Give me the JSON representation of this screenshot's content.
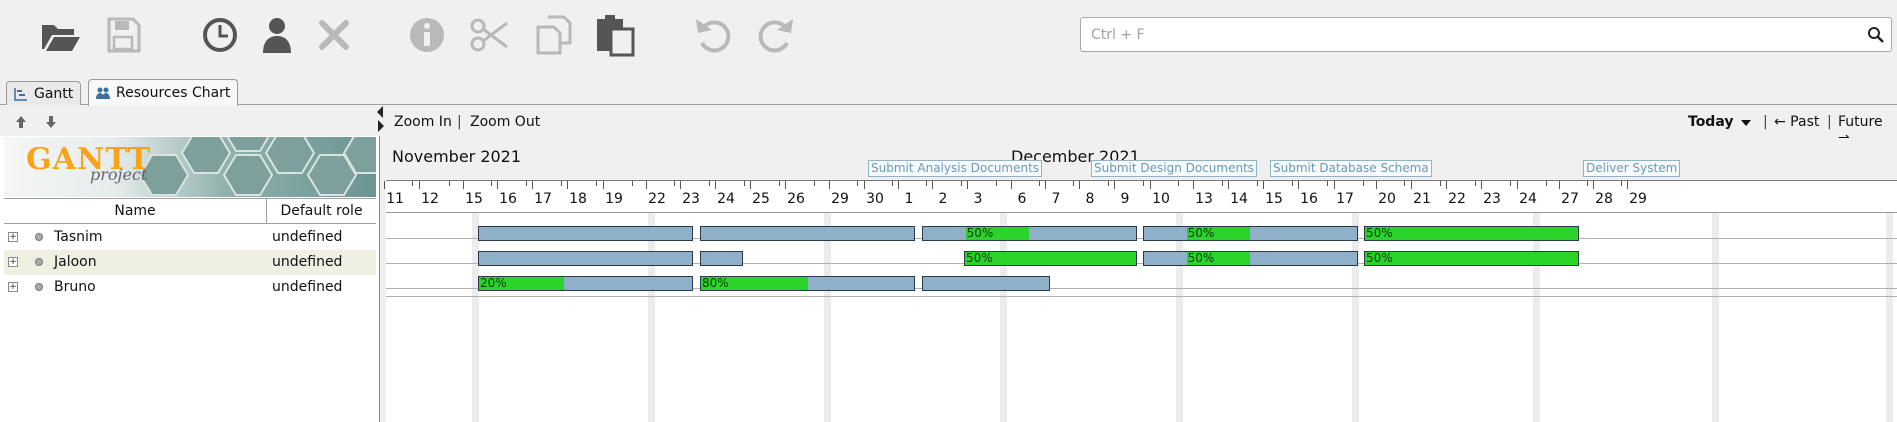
{
  "toolbar": {
    "icons": [
      "open-folder-icon",
      "save-icon",
      "history-icon",
      "user-icon",
      "delete-icon",
      "info-icon",
      "cut-icon",
      "copy-icon",
      "paste-icon",
      "undo-icon",
      "redo-icon"
    ]
  },
  "search": {
    "placeholder": "Ctrl + F"
  },
  "tabs": [
    {
      "label": "Gantt",
      "active": false
    },
    {
      "label": "Resources Chart",
      "active": true
    }
  ],
  "left_panel": {
    "logo_text": "GANTT project",
    "columns": {
      "name": "Name",
      "role": "Default role"
    },
    "resources": [
      {
        "name": "Tasnim",
        "role": "undefined"
      },
      {
        "name": "Jaloon",
        "role": "undefined"
      },
      {
        "name": "Bruno",
        "role": "undefined"
      }
    ]
  },
  "chart": {
    "zoom_in": "Zoom In",
    "sep1": "|",
    "zoom_out": "Zoom Out",
    "today": "Today",
    "sep2": "|",
    "past": "← Past",
    "sep3": "|",
    "future": "Future →",
    "months": [
      "November 2021",
      "December 2021"
    ],
    "milestones": [
      "Submit Analysis Documents",
      "Submit Design Documents",
      "Submit Database Schema",
      "Deliver System"
    ],
    "days": [
      "11",
      "12",
      "15",
      "16",
      "17",
      "18",
      "19",
      "22",
      "23",
      "24",
      "25",
      "26",
      "29",
      "30",
      "1",
      "2",
      "3",
      "6",
      "7",
      "8",
      "9",
      "10",
      "13",
      "14",
      "15",
      "16",
      "17",
      "20",
      "21",
      "22",
      "23",
      "24",
      "27",
      "28",
      "29"
    ],
    "bars": [
      {
        "row": 0,
        "label": ""
      },
      {
        "row": 0,
        "label": ""
      },
      {
        "row": 0,
        "label": "50%"
      },
      {
        "row": 0,
        "label": "50%"
      },
      {
        "row": 0,
        "label": "50%"
      },
      {
        "row": 1,
        "label": ""
      },
      {
        "row": 1,
        "label": ""
      },
      {
        "row": 1,
        "label": "50%"
      },
      {
        "row": 1,
        "label": "50%"
      },
      {
        "row": 1,
        "label": "50%"
      },
      {
        "row": 2,
        "label": "20%"
      },
      {
        "row": 2,
        "label": "80%"
      },
      {
        "row": 2,
        "label": ""
      }
    ]
  },
  "colors": {
    "bar": "#8eb1c9",
    "progress": "#2ad42a",
    "milestone": "#6a9ab6"
  }
}
